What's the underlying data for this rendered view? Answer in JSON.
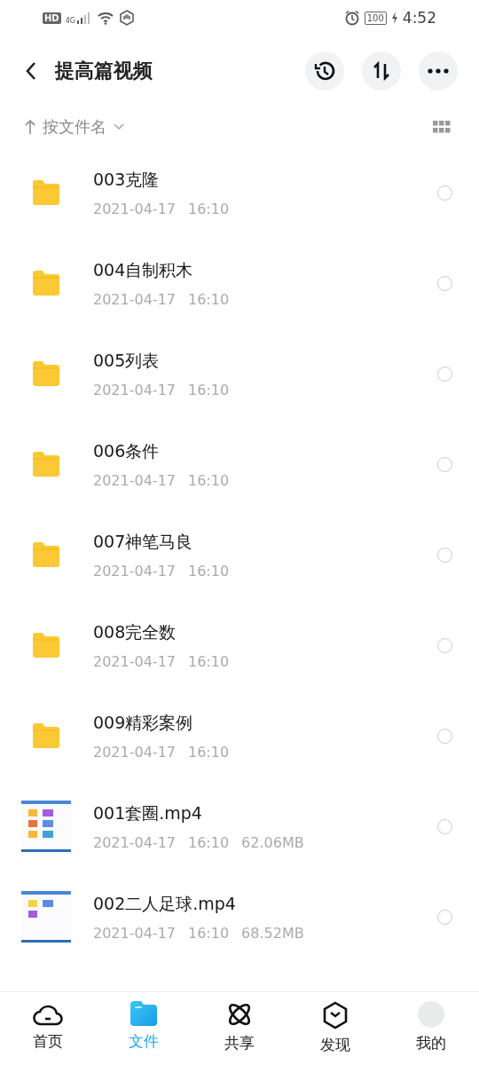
{
  "status_bar": {
    "hd": "HD",
    "network": "4G",
    "battery": "100",
    "time": "4:52"
  },
  "header": {
    "title": "提高篇视频"
  },
  "sort_bar": {
    "label": "按文件名"
  },
  "files": [
    {
      "kind": "folder",
      "name": "003克隆",
      "date": "2021-04-17",
      "time": "16:10",
      "selected": false
    },
    {
      "kind": "folder",
      "name": "004自制积木",
      "date": "2021-04-17",
      "time": "16:10",
      "selected": false
    },
    {
      "kind": "folder",
      "name": "005列表",
      "date": "2021-04-17",
      "time": "16:10",
      "selected": false
    },
    {
      "kind": "folder",
      "name": "006条件",
      "date": "2021-04-17",
      "time": "16:10",
      "selected": false
    },
    {
      "kind": "folder",
      "name": "007神笔马良",
      "date": "2021-04-17",
      "time": "16:10",
      "selected": false
    },
    {
      "kind": "folder",
      "name": "008完全数",
      "date": "2021-04-17",
      "time": "16:10",
      "selected": false
    },
    {
      "kind": "folder",
      "name": "009精彩案例",
      "date": "2021-04-17",
      "time": "16:10",
      "selected": false
    },
    {
      "kind": "video",
      "name": "001套圈.mp4",
      "date": "2021-04-17",
      "time": "16:10",
      "size": "62.06MB",
      "selected": false
    },
    {
      "kind": "video",
      "name": "002二人足球.mp4",
      "date": "2021-04-17",
      "time": "16:10",
      "size": "68.52MB",
      "selected": false
    }
  ],
  "bottom_nav": [
    {
      "kind": "cloud",
      "label": "首页",
      "selected": false
    },
    {
      "kind": "folder",
      "label": "文件",
      "selected": true
    },
    {
      "kind": "atom",
      "label": "共享",
      "selected": false
    },
    {
      "kind": "cube",
      "label": "发现",
      "selected": false
    },
    {
      "kind": "avatar",
      "label": "我的",
      "selected": false
    }
  ]
}
